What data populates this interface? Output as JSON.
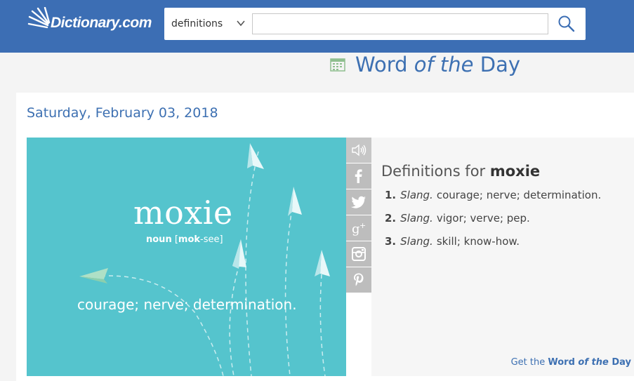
{
  "header": {
    "logo_text": "Dictionary.com",
    "search_category": "definitions",
    "search_value": "",
    "search_icon": "magnifier-icon"
  },
  "wotd": {
    "title_part1": "Word ",
    "title_part2": "of the",
    "title_part3": " Day",
    "icon": "calendar-icon"
  },
  "entry": {
    "date": "Saturday, February 03, 2018",
    "word": "moxie",
    "image": {
      "word": "moxie",
      "pos": "noun",
      "pron_bold": "mok",
      "pron_rest": "-see",
      "definition": "courage; nerve; determination."
    },
    "share_icons": [
      "speaker-icon",
      "facebook-icon",
      "twitter-icon",
      "google-plus-icon",
      "instagram-icon",
      "pinterest-icon"
    ],
    "definitions_label": "Definitions for",
    "definitions": [
      {
        "num": "1.",
        "label": "Slang.",
        "text": "courage; nerve; determination."
      },
      {
        "num": "2.",
        "label": "Slang.",
        "text": "vigor; verve; pep."
      },
      {
        "num": "3.",
        "label": "Slang.",
        "text": "skill; know-how."
      }
    ],
    "get_link": {
      "part1": "Get the ",
      "part2": "Word ",
      "part3": "of the",
      "part4": " Day"
    }
  }
}
